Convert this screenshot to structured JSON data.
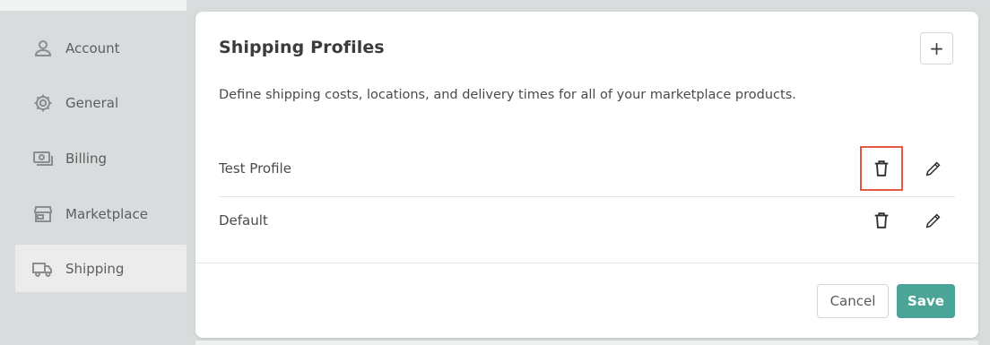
{
  "sidebar": {
    "items": [
      {
        "label": "Account",
        "icon": "person-icon"
      },
      {
        "label": "General",
        "icon": "gear-icon"
      },
      {
        "label": "Billing",
        "icon": "money-icon"
      },
      {
        "label": "Marketplace",
        "icon": "storefront-icon"
      },
      {
        "label": "Shipping",
        "icon": "truck-icon",
        "active": true
      }
    ]
  },
  "card": {
    "title": "Shipping Profiles",
    "add_label": "+",
    "description": "Define shipping costs, locations, and delivery times for all of your marketplace products.",
    "profiles": [
      {
        "name": "Test Profile"
      },
      {
        "name": "Default"
      }
    ],
    "cancel_label": "Cancel",
    "save_label": "Save"
  },
  "colors": {
    "accent": "#4aa596",
    "highlight": "#e35a3e"
  }
}
